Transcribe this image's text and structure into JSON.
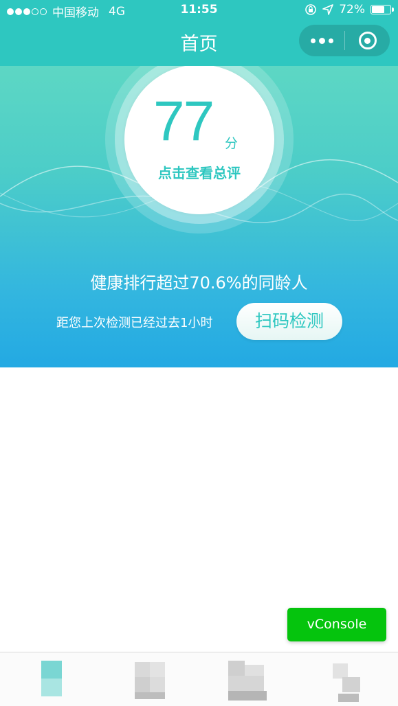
{
  "status_bar": {
    "carrier": "中国移动",
    "network": "4G",
    "time": "11:55",
    "battery": "72%",
    "battery_level": 0.72
  },
  "nav": {
    "title": "首页"
  },
  "score": {
    "value": "77",
    "unit": "分",
    "link": "点击查看总评"
  },
  "ranking_text": "健康排行超过70.6%的同龄人",
  "last_check_text": "距您上次检测已经过去1小时",
  "scan_button": "扫码检测",
  "vconsole": "vConsole",
  "colors": {
    "accent": "#2ec7c0",
    "hero_top": "#5dd7c4",
    "hero_bottom": "#23a9e3",
    "vconsole": "#05c40d"
  },
  "tabs": [
    {
      "name": "tab-home",
      "icon": "pixelated-icon",
      "active": true
    },
    {
      "name": "tab-2",
      "icon": "pixelated-icon",
      "active": false
    },
    {
      "name": "tab-3",
      "icon": "pixelated-icon",
      "active": false
    },
    {
      "name": "tab-4",
      "icon": "pixelated-icon",
      "active": false
    }
  ]
}
